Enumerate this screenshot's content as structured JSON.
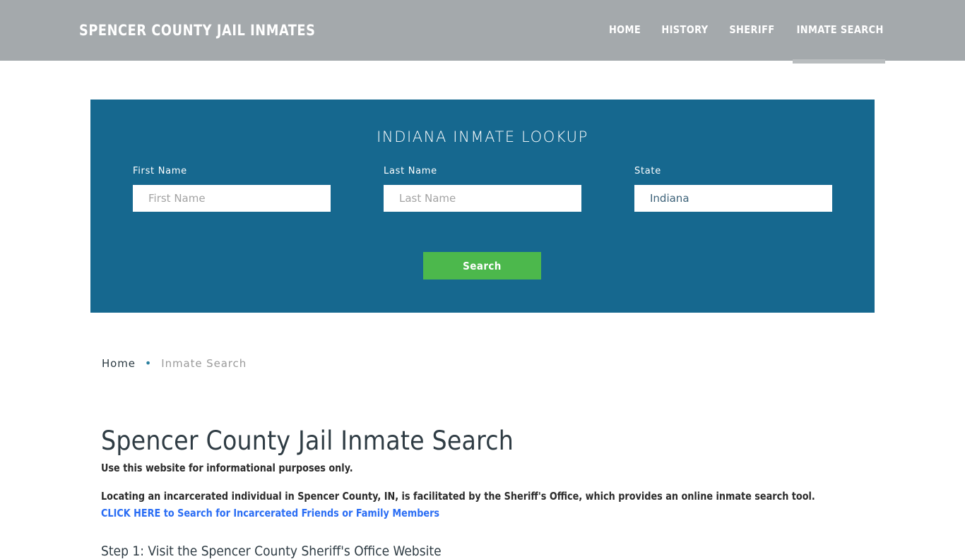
{
  "header": {
    "site_title": "SPENCER COUNTY JAIL INMATES",
    "nav": [
      {
        "label": "HOME",
        "active": false
      },
      {
        "label": "HISTORY",
        "active": false
      },
      {
        "label": "SHERIFF",
        "active": false
      },
      {
        "label": "INMATE SEARCH",
        "active": true
      }
    ],
    "background_color": "#a4a9ac"
  },
  "lookup": {
    "title": "INDIANA INMATE LOOKUP",
    "panel_color": "#16688f",
    "fields": {
      "first_name": {
        "label": "First Name",
        "placeholder": "First Name",
        "value": ""
      },
      "last_name": {
        "label": "Last Name",
        "placeholder": "Last Name",
        "value": ""
      },
      "state": {
        "label": "State",
        "placeholder": "State",
        "value": "Indiana"
      }
    },
    "search_button_label": "Search",
    "search_button_color": "#4cb84c"
  },
  "breadcrumb": {
    "home_label": "Home",
    "separator": "•",
    "current_label": "Inmate Search"
  },
  "content": {
    "heading": "Spencer County Jail Inmate Search",
    "paragraph_1": "Use this website for informational purposes only.",
    "paragraph_2": "Locating an incarcerated individual in Spencer County, IN, is facilitated by the Sheriff's Office, which provides an online inmate search tool.",
    "link_label": "CLICK HERE to Search for Incarcerated Friends or Family Members",
    "link_color": "#2a6df4",
    "step_1": "Step 1: Visit the Spencer County Sheriff's Office Website"
  }
}
